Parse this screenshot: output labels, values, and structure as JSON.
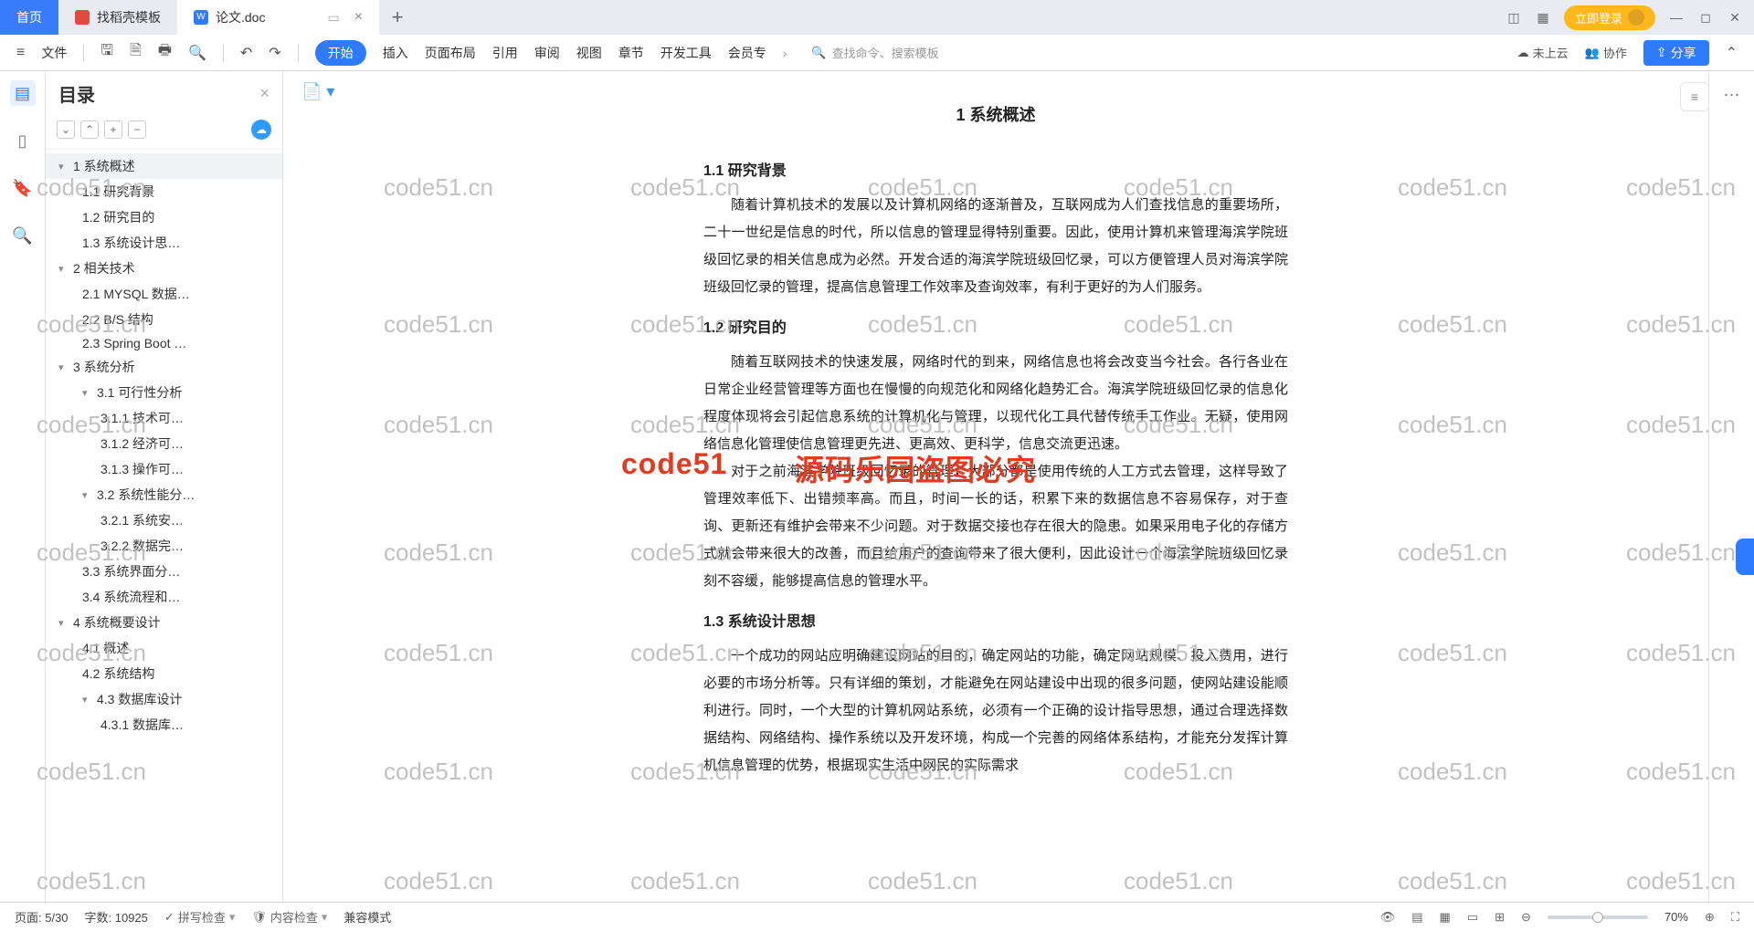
{
  "tabs": {
    "home": "首页",
    "t1": "找稻壳模板",
    "t2": "论文.doc"
  },
  "login": "立即登录",
  "ribbon": {
    "file": "文件",
    "items": [
      "开始",
      "插入",
      "页面布局",
      "引用",
      "审阅",
      "视图",
      "章节",
      "开发工具",
      "会员专"
    ],
    "search_placeholder": "查找命令、搜索模板",
    "cloud": "未上云",
    "coop": "协作",
    "share": "分享"
  },
  "outline": {
    "title": "目录",
    "items": [
      {
        "lvl": 1,
        "caret": true,
        "label": "1 系统概述",
        "sel": true
      },
      {
        "lvl": 2,
        "label": "1.1 研究背景"
      },
      {
        "lvl": 2,
        "label": "1.2 研究目的"
      },
      {
        "lvl": 2,
        "label": "1.3 系统设计思…"
      },
      {
        "lvl": 1,
        "caret": true,
        "label": "2 相关技术"
      },
      {
        "lvl": 2,
        "label": "2.1 MYSQL 数据…"
      },
      {
        "lvl": 2,
        "label": "2.2 B/S 结构"
      },
      {
        "lvl": 2,
        "label": "2.3 Spring Boot …"
      },
      {
        "lvl": 1,
        "caret": true,
        "label": "3 系统分析"
      },
      {
        "lvl": 2,
        "caret": true,
        "label": "3.1 可行性分析"
      },
      {
        "lvl": 3,
        "label": "3.1.1 技术可…"
      },
      {
        "lvl": 3,
        "label": "3.1.2 经济可…"
      },
      {
        "lvl": 3,
        "label": "3.1.3 操作可…"
      },
      {
        "lvl": 2,
        "caret": true,
        "label": "3.2 系统性能分…"
      },
      {
        "lvl": 3,
        "label": "3.2.1 系统安…"
      },
      {
        "lvl": 3,
        "label": "3.2.2 数据完…"
      },
      {
        "lvl": 2,
        "label": "3.3 系统界面分…"
      },
      {
        "lvl": 2,
        "label": "3.4 系统流程和…"
      },
      {
        "lvl": 1,
        "caret": true,
        "label": "4 系统概要设计"
      },
      {
        "lvl": 2,
        "label": "4.1 概述"
      },
      {
        "lvl": 2,
        "label": "4.2 系统结构"
      },
      {
        "lvl": 2,
        "caret": true,
        "label": "4.3 数据库设计"
      },
      {
        "lvl": 3,
        "label": "4.3.1 数据库…"
      }
    ]
  },
  "doc": {
    "h1": "1 系统概述",
    "s11": "1.1 研究背景",
    "p11": "随着计算机技术的发展以及计算机网络的逐渐普及，互联网成为人们查找信息的重要场所，二十一世纪是信息的时代，所以信息的管理显得特别重要。因此，使用计算机来管理海滨学院班级回忆录的相关信息成为必然。开发合适的海滨学院班级回忆录，可以方便管理人员对海滨学院班级回忆录的管理，提高信息管理工作效率及查询效率，有利于更好的为人们服务。",
    "s12": "1.2 研究目的",
    "p12a": "随着互联网技术的快速发展，网络时代的到来，网络信息也将会改变当今社会。各行各业在日常企业经营管理等方面也在慢慢的向规范化和网络化趋势汇合。海滨学院班级回忆录的信息化程度体现将会引起信息系统的计算机化与管理，以现代化工具代替传统手工作业。无疑，使用网络信息化管理使信息管理更先进、更高效、更科学，信息交流更迅速。",
    "p12b": "对于之前海滨学院班级回忆录的管理，大部分都是使用传统的人工方式去管理，这样导致了管理效率低下、出错频率高。而且，时间一长的话，积累下来的数据信息不容易保存，对于查询、更新还有维护会带来不少问题。对于数据交接也存在很大的隐患。如果采用电子化的存储方式就会带来很大的改善，而且给用户的查询带来了很大便利，因此设计一个海滨学院班级回忆录刻不容缓，能够提高信息的管理水平。",
    "s13": "1.3 系统设计思想",
    "p13": "一个成功的网站应明确建设网站的目的，确定网站的功能，确定网站规模、投入费用，进行必要的市场分析等。只有详细的策划，才能避免在网站建设中出现的很多问题，使网站建设能顺利进行。同时，一个大型的计算机网站系统，必须有一个正确的设计指导思想，通过合理选择数据结构、网络结构、操作系统以及开发环境，构成一个完善的网络体系结构，才能充分发挥计算机信息管理的优势，根据现实生活中网民的实际需求"
  },
  "status": {
    "page": "页面: 5/30",
    "words": "字数: 10925",
    "spell": "拼写检查",
    "content": "内容检查",
    "compat": "兼容模式",
    "zoom": "70%"
  },
  "watermark": "code51.cn",
  "red_wm_left": "code51",
  "red_wm_right": "源码乐园盗图必究"
}
